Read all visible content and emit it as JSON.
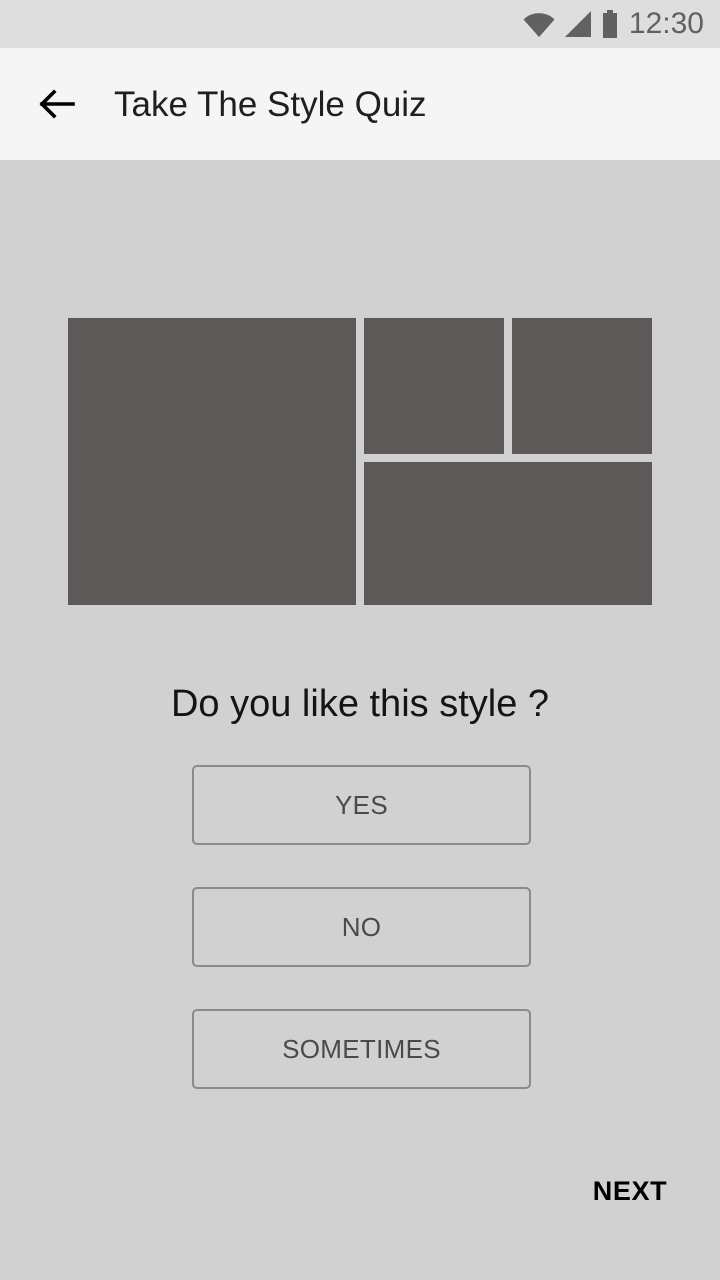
{
  "status_bar": {
    "time": "12:30",
    "icons": [
      "wifi-icon",
      "cellular-signal-icon",
      "battery-icon"
    ],
    "background_color": "#dedede",
    "foreground_color": "#616161"
  },
  "app_bar": {
    "title": "Take The Style Quiz",
    "back_icon": "back-arrow-icon",
    "background_color": "#f5f5f5",
    "title_color": "#1f1f1f"
  },
  "content": {
    "background_color": "#d1d1d1",
    "collage": {
      "tile_color": "#5e5959",
      "tiles": [
        {
          "name": "style-image-large-left"
        },
        {
          "name": "style-image-top-middle"
        },
        {
          "name": "style-image-top-right"
        },
        {
          "name": "style-image-bottom-right"
        }
      ]
    },
    "question": "Do you like this style ?",
    "options": [
      {
        "label": "YES"
      },
      {
        "label": "NO"
      },
      {
        "label": "SOMETIMES"
      }
    ],
    "next_label": "NEXT",
    "option_border_color": "#8a8a8a",
    "option_text_color": "#4a4a4a",
    "next_text_color": "#000000"
  }
}
